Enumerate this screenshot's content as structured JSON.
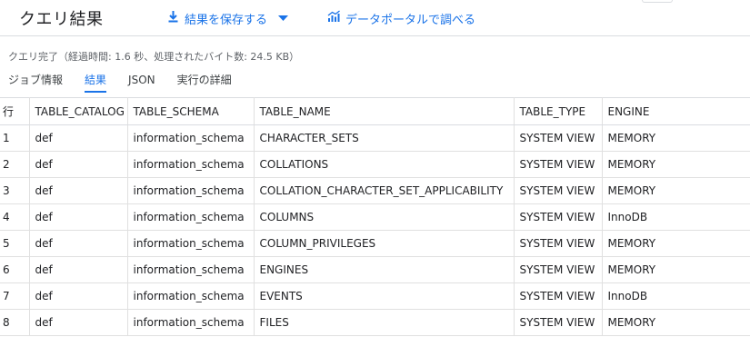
{
  "header": {
    "title": "クエリ結果",
    "save_label": "結果を保存する",
    "studio_label": "データポータルで調べる"
  },
  "status": "クエリ完了（経過時間: 1.6 秒、処理されたバイト数: 24.5 KB）",
  "tabs": [
    {
      "label": "ジョブ情報",
      "active": false
    },
    {
      "label": "結果",
      "active": true
    },
    {
      "label": "JSON",
      "active": false
    },
    {
      "label": "実行の詳細",
      "active": false
    }
  ],
  "colors": {
    "accent": "#1a73e8"
  },
  "icons": {
    "save": "download-icon",
    "save_menu": "caret-down-icon",
    "studio": "bar-chart-icon"
  },
  "table": {
    "columns": [
      "行",
      "TABLE_CATALOG",
      "TABLE_SCHEMA",
      "TABLE_NAME",
      "TABLE_TYPE",
      "ENGINE"
    ],
    "rows": [
      [
        "1",
        "def",
        "information_schema",
        "CHARACTER_SETS",
        "SYSTEM VIEW",
        "MEMORY"
      ],
      [
        "2",
        "def",
        "information_schema",
        "COLLATIONS",
        "SYSTEM VIEW",
        "MEMORY"
      ],
      [
        "3",
        "def",
        "information_schema",
        "COLLATION_CHARACTER_SET_APPLICABILITY",
        "SYSTEM VIEW",
        "MEMORY"
      ],
      [
        "4",
        "def",
        "information_schema",
        "COLUMNS",
        "SYSTEM VIEW",
        "InnoDB"
      ],
      [
        "5",
        "def",
        "information_schema",
        "COLUMN_PRIVILEGES",
        "SYSTEM VIEW",
        "MEMORY"
      ],
      [
        "6",
        "def",
        "information_schema",
        "ENGINES",
        "SYSTEM VIEW",
        "MEMORY"
      ],
      [
        "7",
        "def",
        "information_schema",
        "EVENTS",
        "SYSTEM VIEW",
        "InnoDB"
      ],
      [
        "8",
        "def",
        "information_schema",
        "FILES",
        "SYSTEM VIEW",
        "MEMORY"
      ]
    ]
  }
}
